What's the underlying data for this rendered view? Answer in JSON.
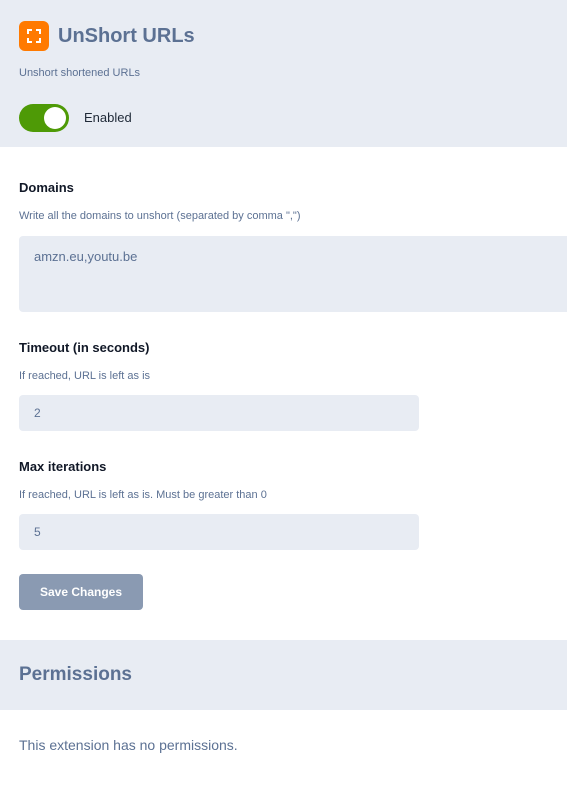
{
  "header": {
    "title": "UnShort URLs",
    "subtitle": "Unshort shortened URLs",
    "icon": "expand-corners-icon",
    "icon_color": "#ff7a00",
    "toggle": {
      "state": "on",
      "label": "Enabled",
      "color": "#4e9a06"
    }
  },
  "settings": {
    "domains": {
      "title": "Domains",
      "help": "Write all the domains to unshort (separated by comma \",\")",
      "value": "amzn.eu,youtu.be"
    },
    "timeout": {
      "title": "Timeout (in seconds)",
      "help": "If reached, URL is left as is",
      "value": "2"
    },
    "max_iterations": {
      "title": "Max iterations",
      "help": "If reached, URL is left as is. Must be greater than 0",
      "value": "5"
    },
    "save_label": "Save Changes"
  },
  "permissions": {
    "title": "Permissions",
    "text": "This extension has no permissions."
  }
}
